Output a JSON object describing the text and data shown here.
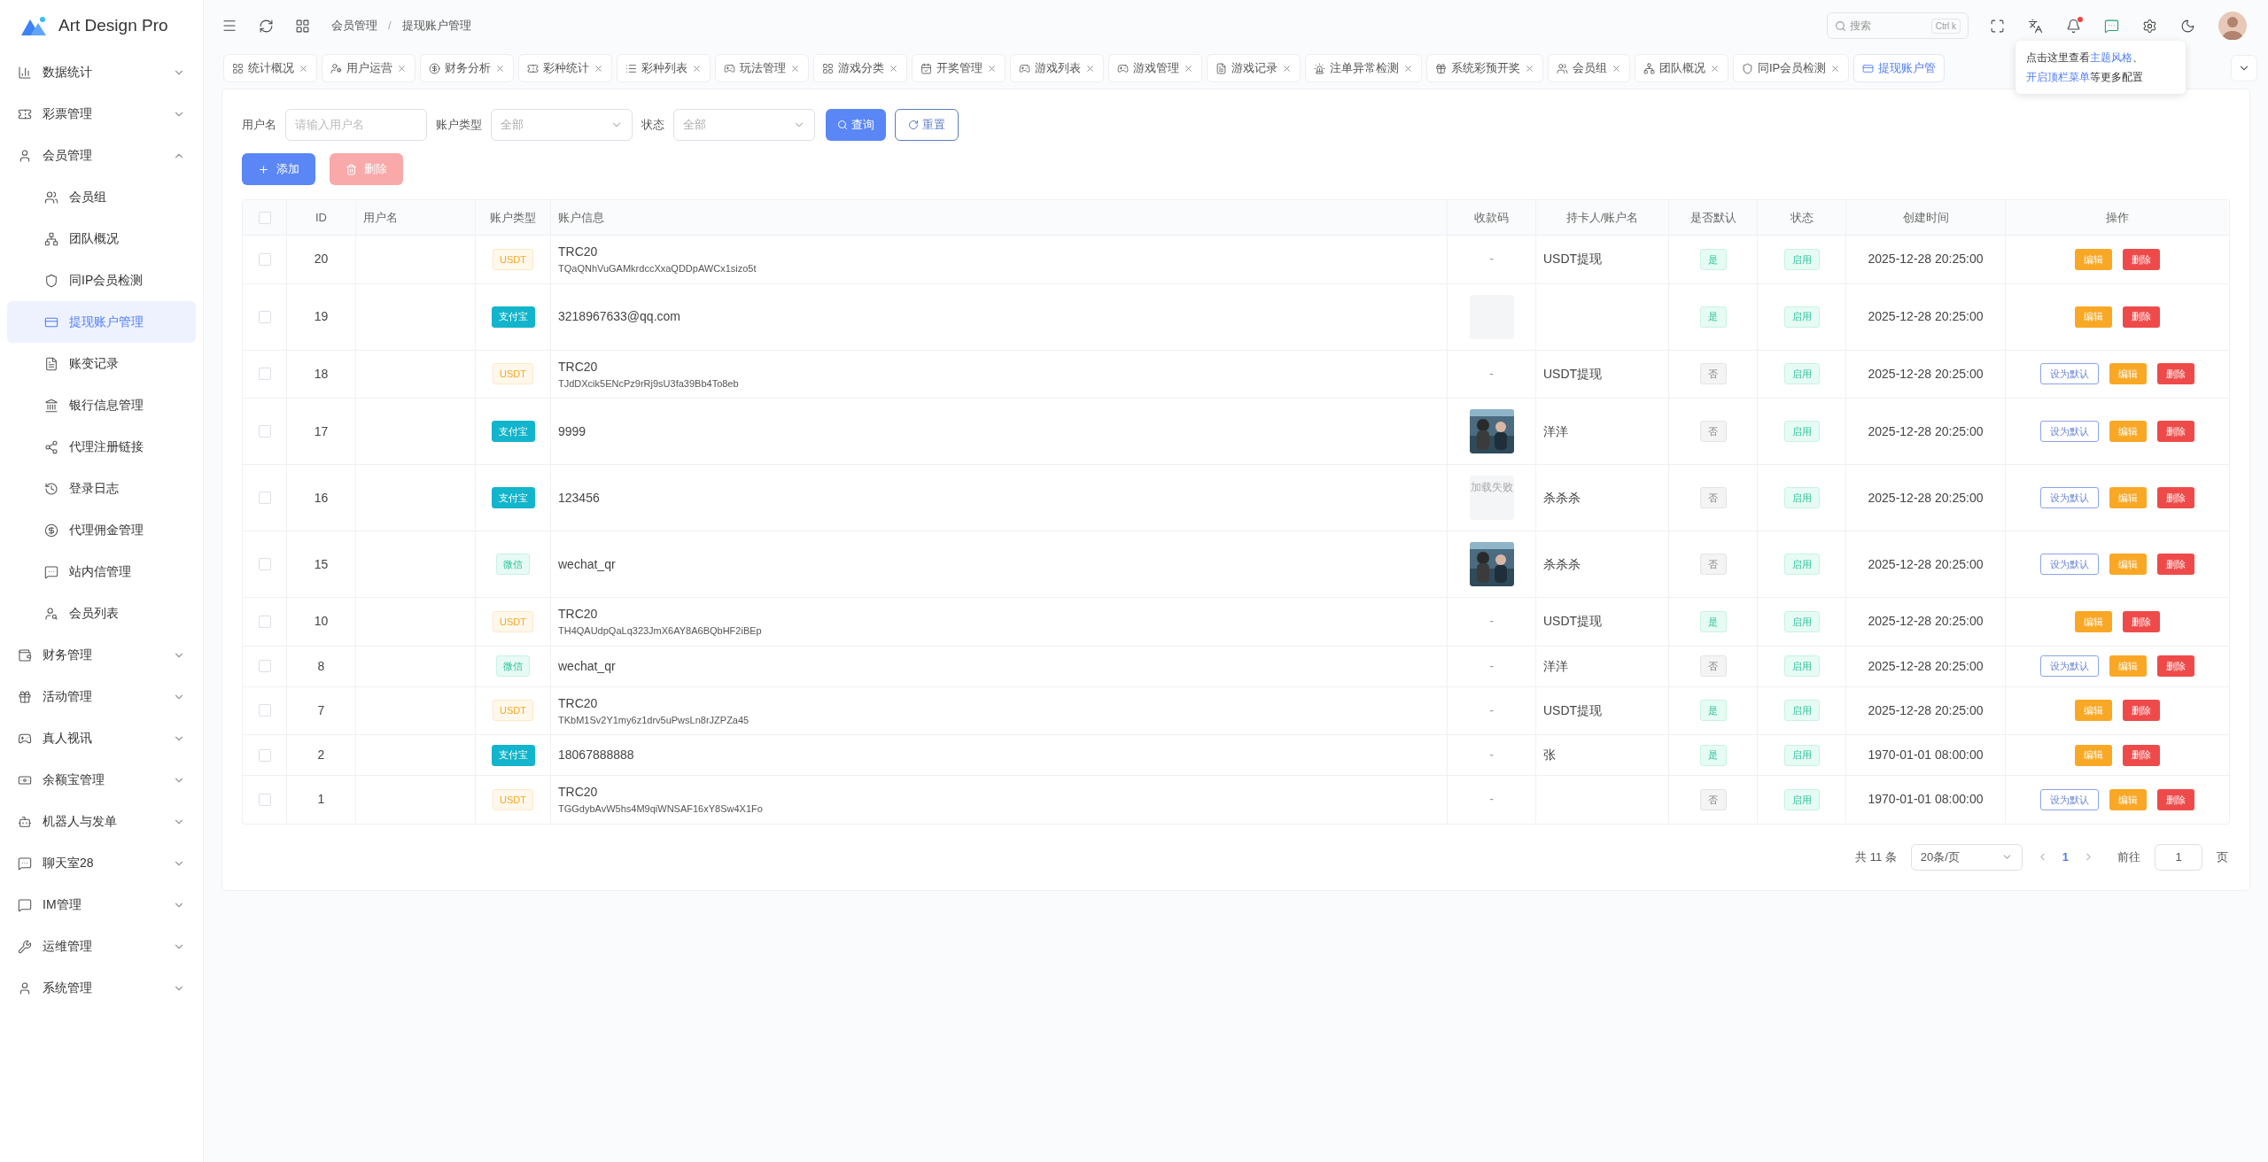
{
  "sidebar": {
    "logo_text": "Art Design Pro",
    "items": [
      {
        "label": "数据统计",
        "expanded": false
      },
      {
        "label": "彩票管理",
        "expanded": false
      },
      {
        "label": "会员管理",
        "expanded": true,
        "children": [
          {
            "label": "会员组",
            "selected": false
          },
          {
            "label": "团队概况",
            "selected": false
          },
          {
            "label": "同IP会员检测",
            "selected": false
          },
          {
            "label": "提现账户管理",
            "selected": true
          },
          {
            "label": "账变记录",
            "selected": false
          },
          {
            "label": "银行信息管理",
            "selected": false
          },
          {
            "label": "代理注册链接",
            "selected": false
          },
          {
            "label": "登录日志",
            "selected": false
          },
          {
            "label": "代理佣金管理",
            "selected": false
          },
          {
            "label": "站内信管理",
            "selected": false
          },
          {
            "label": "会员列表",
            "selected": false
          }
        ]
      },
      {
        "label": "财务管理",
        "expanded": false
      },
      {
        "label": "活动管理",
        "expanded": false
      },
      {
        "label": "真人视讯",
        "expanded": false
      },
      {
        "label": "余额宝管理",
        "expanded": false
      },
      {
        "label": "机器人与发单",
        "expanded": false
      },
      {
        "label": "聊天室28",
        "expanded": false
      },
      {
        "label": "IM管理",
        "expanded": false
      },
      {
        "label": "运维管理",
        "expanded": false
      },
      {
        "label": "系统管理",
        "expanded": false
      }
    ]
  },
  "topbar": {
    "breadcrumb": [
      "会员管理",
      "提现账户管理"
    ],
    "breadcrumb_separator": "/",
    "search": {
      "placeholder": "搜索",
      "shortcut": "Ctrl k"
    }
  },
  "tabs": [
    {
      "label": "统计概况",
      "selected": false
    },
    {
      "label": "用户运营",
      "selected": false
    },
    {
      "label": "财务分析",
      "selected": false
    },
    {
      "label": "彩种统计",
      "selected": false
    },
    {
      "label": "彩种列表",
      "selected": false
    },
    {
      "label": "玩法管理",
      "selected": false
    },
    {
      "label": "游戏分类",
      "selected": false
    },
    {
      "label": "开奖管理",
      "selected": false
    },
    {
      "label": "游戏列表",
      "selected": false
    },
    {
      "label": "游戏管理",
      "selected": false
    },
    {
      "label": "游戏记录",
      "selected": false
    },
    {
      "label": "注单异常检测",
      "selected": false
    },
    {
      "label": "系统彩预开奖",
      "selected": false
    },
    {
      "label": "会员组",
      "selected": false
    },
    {
      "label": "团队概况",
      "selected": false
    },
    {
      "label": "同IP会员检测",
      "selected": false
    },
    {
      "label": "提现账户管",
      "selected": true
    }
  ],
  "tooltip": {
    "lines": [
      [
        {
          "text": "点击这里查看",
          "highlight": false
        },
        {
          "text": "主题风格",
          "highlight": true
        },
        {
          "text": "、",
          "highlight": false
        }
      ],
      [
        {
          "text": "开启顶栏菜单",
          "highlight": true
        },
        {
          "text": "等更多配置",
          "highlight": false
        }
      ]
    ]
  },
  "filters": [
    {
      "label": "用户名",
      "kind": "input",
      "placeholder": "请输入用户名"
    },
    {
      "label": "账户类型",
      "kind": "select",
      "value": "全部"
    },
    {
      "label": "状态",
      "kind": "select",
      "value": "全部"
    }
  ],
  "search_button": "查询",
  "reset_button": "重置",
  "add_button": "添加",
  "delete_button": {
    "label": "删除",
    "disabled": true
  },
  "table": {
    "header_checked": false,
    "columns": [
      "ID",
      "用户名",
      "账户类型",
      "账户信息",
      "收款码",
      "持卡人/账户名",
      "是否默认",
      "状态",
      "创建时间",
      "操作"
    ],
    "rows": [
      {
        "checked": false,
        "id": "20",
        "type": {
          "label": "USDT",
          "kind": "usdt"
        },
        "info": {
          "title": "TRC20",
          "sub": "TQaQNhVuGAMkrdccXxaQDDpAWCx1sizo5t"
        },
        "qr": {
          "kind": "none",
          "text": "-"
        },
        "holder": "USDT提现",
        "default": {
          "label": "是",
          "on": true
        },
        "status": "启用",
        "created": "2025-12-28 20:25:00",
        "actions": [
          {
            "label": "编辑",
            "kind": "edit"
          },
          {
            "label": "删除",
            "kind": "delete"
          }
        ]
      },
      {
        "checked": false,
        "id": "19",
        "type": {
          "label": "支付宝",
          "kind": "alipay"
        },
        "info": {
          "title": "3218967633@qq.com"
        },
        "qr": {
          "kind": "blank"
        },
        "default": {
          "label": "是",
          "on": true
        },
        "status": "启用",
        "created": "2025-12-28 20:25:00",
        "actions": [
          {
            "label": "编辑",
            "kind": "edit"
          },
          {
            "label": "删除",
            "kind": "delete"
          }
        ]
      },
      {
        "checked": false,
        "id": "18",
        "type": {
          "label": "USDT",
          "kind": "usdt"
        },
        "info": {
          "title": "TRC20",
          "sub": "TJdDXcik5ENcPz9rRj9sU3fa39Bb4To8eb"
        },
        "qr": {
          "kind": "none",
          "text": "-"
        },
        "holder": "USDT提现",
        "default": {
          "label": "否",
          "on": false
        },
        "status": "启用",
        "created": "2025-12-28 20:25:00",
        "actions": [
          {
            "label": "设为默认",
            "kind": "set_default"
          },
          {
            "label": "编辑",
            "kind": "edit"
          },
          {
            "label": "删除",
            "kind": "delete"
          }
        ]
      },
      {
        "checked": false,
        "id": "17",
        "type": {
          "label": "支付宝",
          "kind": "alipay"
        },
        "info": {
          "title": "9999"
        },
        "holder": "洋洋",
        "default": {
          "label": "否",
          "on": false
        },
        "status": "启用",
        "created": "2025-12-28 20:25:00",
        "actions": [
          {
            "label": "设为默认",
            "kind": "set_default"
          },
          {
            "label": "编辑",
            "kind": "edit"
          },
          {
            "label": "删除",
            "kind": "delete"
          }
        ]
      },
      {
        "checked": false,
        "id": "16",
        "type": {
          "label": "支付宝",
          "kind": "alipay"
        },
        "info": {
          "title": "123456"
        },
        "qr": {
          "kind": "failed",
          "text": "加载失败"
        },
        "holder": "杀杀杀",
        "default": {
          "label": "否",
          "on": false
        },
        "status": "启用",
        "created": "2025-12-28 20:25:00",
        "actions": [
          {
            "label": "设为默认",
            "kind": "set_default"
          },
          {
            "label": "编辑",
            "kind": "edit"
          },
          {
            "label": "删除",
            "kind": "delete"
          }
        ]
      },
      {
        "checked": false,
        "id": "15",
        "type": {
          "label": "微信",
          "kind": "wechat"
        },
        "info": {
          "title": "wechat_qr"
        },
        "holder": "杀杀杀",
        "default": {
          "label": "否",
          "on": false
        },
        "status": "启用",
        "created": "2025-12-28 20:25:00",
        "actions": [
          {
            "label": "设为默认",
            "kind": "set_default"
          },
          {
            "label": "编辑",
            "kind": "edit"
          },
          {
            "label": "删除",
            "kind": "delete"
          }
        ]
      },
      {
        "checked": false,
        "id": "10",
        "type": {
          "label": "USDT",
          "kind": "usdt"
        },
        "info": {
          "title": "TRC20",
          "sub": "TH4QAUdpQaLq323JmX6AY8A6BQbHF2iBEp"
        },
        "qr": {
          "kind": "none",
          "text": "-"
        },
        "holder": "USDT提现",
        "default": {
          "label": "是",
          "on": true
        },
        "status": "启用",
        "created": "2025-12-28 20:25:00",
        "actions": [
          {
            "label": "编辑",
            "kind": "edit"
          },
          {
            "label": "删除",
            "kind": "delete"
          }
        ]
      },
      {
        "checked": false,
        "id": "8",
        "type": {
          "label": "微信",
          "kind": "wechat"
        },
        "info": {
          "title": "wechat_qr"
        },
        "qr": {
          "kind": "none",
          "text": "-"
        },
        "holder": "洋洋",
        "default": {
          "label": "否",
          "on": false
        },
        "status": "启用",
        "created": "2025-12-28 20:25:00",
        "actions": [
          {
            "label": "设为默认",
            "kind": "set_default"
          },
          {
            "label": "编辑",
            "kind": "edit"
          },
          {
            "label": "删除",
            "kind": "delete"
          }
        ]
      },
      {
        "checked": false,
        "id": "7",
        "type": {
          "label": "USDT",
          "kind": "usdt"
        },
        "info": {
          "title": "TRC20",
          "sub": "TKbM1Sv2Y1my6z1drv5uPwsLn8rJZPZa45"
        },
        "qr": {
          "kind": "none",
          "text": "-"
        },
        "holder": "USDT提现",
        "default": {
          "label": "是",
          "on": true
        },
        "status": "启用",
        "created": "2025-12-28 20:25:00",
        "actions": [
          {
            "label": "编辑",
            "kind": "edit"
          },
          {
            "label": "删除",
            "kind": "delete"
          }
        ]
      },
      {
        "checked": false,
        "id": "2",
        "type": {
          "label": "支付宝",
          "kind": "alipay"
        },
        "info": {
          "title": "18067888888"
        },
        "qr": {
          "kind": "none",
          "text": "-"
        },
        "holder": "张",
        "default": {
          "label": "是",
          "on": true
        },
        "status": "启用",
        "created": "1970-01-01 08:00:00",
        "actions": [
          {
            "label": "编辑",
            "kind": "edit"
          },
          {
            "label": "删除",
            "kind": "delete"
          }
        ]
      },
      {
        "checked": false,
        "id": "1",
        "type": {
          "label": "USDT",
          "kind": "usdt"
        },
        "info": {
          "title": "TRC20",
          "sub": "TGGdybAvW5hs4M9qiWNSAF16xY8Sw4X1Fo"
        },
        "qr": {
          "kind": "none",
          "text": "-"
        },
        "default": {
          "label": "否",
          "on": false
        },
        "status": "启用",
        "created": "1970-01-01 08:00:00",
        "actions": [
          {
            "label": "设为默认",
            "kind": "set_default"
          },
          {
            "label": "编辑",
            "kind": "edit"
          },
          {
            "label": "删除",
            "kind": "delete"
          }
        ]
      }
    ]
  },
  "pagination": {
    "total": "共 11 条",
    "page_size": "20条/页",
    "pages": [
      {
        "label": "1",
        "selected": true
      }
    ],
    "goto_label": "前往",
    "goto_value": "1",
    "suffix": "页"
  }
}
